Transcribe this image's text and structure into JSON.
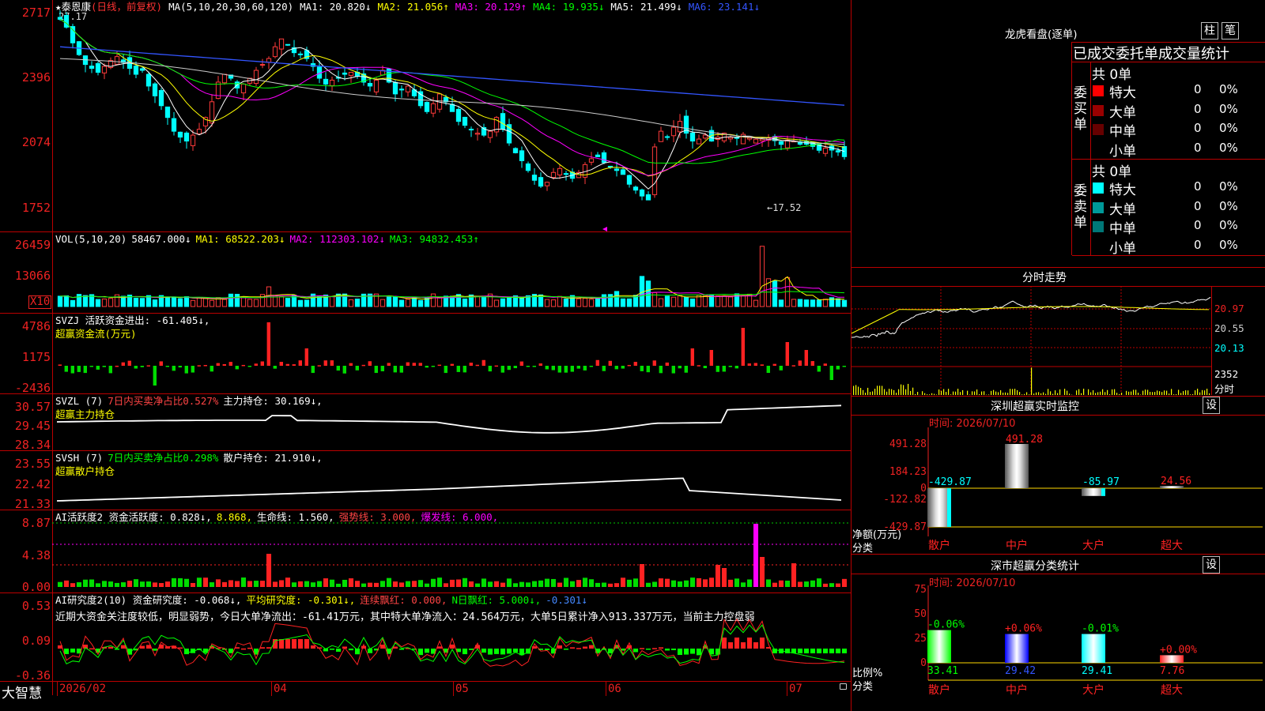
{
  "stock_name": "★泰恩康",
  "period": "(日线，前复权)",
  "high_mark": "27.17",
  "low_mark": "←17.52",
  "price_axis": [
    "2717",
    "2396",
    "2074",
    "1752"
  ],
  "ma_values": [
    {
      "label": "MA(5,10,20,30,60,120)",
      "color": "#ffffff"
    },
    {
      "label": "MA1: 20.820↓",
      "color": "#ffffff"
    },
    {
      "label": "MA2: 21.056↑",
      "color": "#ffff00"
    },
    {
      "label": "MA3: 20.129↑",
      "color": "#ff00ff"
    },
    {
      "label": "MA4: 19.935↓",
      "color": "#00ff00"
    },
    {
      "label": "MA5: 21.499↓",
      "color": "#ffffff"
    },
    {
      "label": "MA6: 23.141↓",
      "color": "#3355ff"
    }
  ],
  "vol": {
    "axis": [
      "26459",
      "13066",
      "X10"
    ],
    "title": [
      {
        "label": "VOL(5,10,20)",
        "color": "#ffffff"
      },
      {
        "label": "58467.000↓",
        "color": "#ffffff"
      },
      {
        "label": "MA1: 68522.203↓",
        "color": "#ffff00"
      },
      {
        "label": "MA2: 112303.102↓",
        "color": "#ff00ff"
      },
      {
        "label": "MA3: 94832.453↑",
        "color": "#00ff00"
      }
    ]
  },
  "svzj": {
    "axis": [
      "4786",
      "1175",
      "-2436"
    ],
    "title": [
      {
        "label": "SVZJ  活跃资金进出: -61.405↓,",
        "color": "#ffffff"
      }
    ],
    "subtitle": "超赢资金流(万元)"
  },
  "svzl": {
    "axis": [
      "30.57",
      "29.45",
      "28.34"
    ],
    "title": [
      {
        "label": "SVZL (7)",
        "color": "#ffffff"
      },
      {
        "label": "7日内买卖净占比0.527%",
        "color": "#ff4444"
      },
      {
        "label": "主力持仓: 30.169↓,",
        "color": "#ffffff"
      }
    ],
    "subtitle": "超赢主力持仓"
  },
  "svsh": {
    "axis": [
      "23.55",
      "22.42",
      "21.33"
    ],
    "title": [
      {
        "label": "SVSH (7)",
        "color": "#ffffff"
      },
      {
        "label": "7日内买卖净占比0.298%",
        "color": "#00ff00"
      },
      {
        "label": "散户持仓: 21.910↓,",
        "color": "#ffffff"
      }
    ],
    "subtitle": "超赢散户持仓"
  },
  "ai2": {
    "axis": [
      "8.87",
      "4.38",
      "0.00"
    ],
    "title": [
      {
        "label": "AI活跃度2 资金活跃度: 0.828↓,",
        "color": "#ffffff"
      },
      {
        "label": "8.868,",
        "color": "#ffff00"
      },
      {
        "label": "生命线: 1.560,",
        "color": "#ffffff"
      },
      {
        "label": "强势线: 3.000,",
        "color": "#ff4444"
      },
      {
        "label": "爆发线: 6.000,",
        "color": "#ff00ff"
      }
    ]
  },
  "research": {
    "axis": [
      "0.53",
      "0.09",
      "-0.36"
    ],
    "title": [
      {
        "label": "AI研究度2(10) 资金研究度: -0.068↓,",
        "color": "#ffffff"
      },
      {
        "label": "平均研究度: -0.301↓,",
        "color": "#ffff00"
      },
      {
        "label": "连续飘红: 0.000,",
        "color": "#ff4444"
      },
      {
        "label": "N日飘红: 5.000↓,",
        "color": "#00ff00"
      },
      {
        "label": "-0.301↓",
        "color": "#4488ff"
      }
    ],
    "comment": "近期大资金关注度较低，明显弱势，今日大单净流出：-61.41万元，其中特大单净流入：24.564万元，大单5日累计净入913.337万元，当前主力控盘弱"
  },
  "dates": [
    "2026/02",
    "04",
    "05",
    "06",
    "07"
  ],
  "brand": "大智慧",
  "lhb": {
    "title": "龙虎看盘(逐单)",
    "btn_bar": "柱",
    "btn_stroke": "笔",
    "subtitle": "已成交委托单成交量统计",
    "buy_label": "委买单",
    "sell_label": "委卖单",
    "buy_total": "共 0单",
    "sell_total": "共 0单",
    "buy_rows": [
      {
        "name": "特大",
        "count": "0",
        "pct": "0%",
        "color": "#ff0000"
      },
      {
        "name": "大单",
        "count": "0",
        "pct": "0%",
        "color": "#990000"
      },
      {
        "name": "中单",
        "count": "0",
        "pct": "0%",
        "color": "#660000"
      },
      {
        "name": "小单",
        "count": "0",
        "pct": "0%",
        "color": "#000000"
      }
    ],
    "sell_rows": [
      {
        "name": "特大",
        "count": "0",
        "pct": "0%",
        "color": "#00ffff"
      },
      {
        "name": "大单",
        "count": "0",
        "pct": "0%",
        "color": "#009999"
      },
      {
        "name": "中单",
        "count": "0",
        "pct": "0%",
        "color": "#007777"
      },
      {
        "name": "小单",
        "count": "0",
        "pct": "0%",
        "color": "#000000"
      }
    ]
  },
  "intraday": {
    "title": "分时走势",
    "axis_right": [
      "20.97",
      "20.55",
      "20.13",
      "2352",
      "分时"
    ]
  },
  "sz_monitor": {
    "title": "深圳超赢实时监控",
    "settings": "设",
    "time": "时间: 2026/07/10",
    "axis": [
      "491.28",
      "184.23",
      "0",
      "-122.82",
      "-429.87"
    ],
    "unit": "净额(万元)",
    "category_label": "分类",
    "categories": [
      "散户",
      "中户",
      "大户",
      "超大"
    ],
    "values": [
      -429.87,
      491.28,
      -85.97,
      24.56
    ],
    "value_labels": [
      "-429.87",
      "491.28",
      "-85.97",
      "24.56"
    ]
  },
  "sz_stats": {
    "title": "深市超赢分类统计",
    "settings": "设",
    "time": "时间: 2026/07/10",
    "axis": [
      "75",
      "50",
      "25",
      "0"
    ],
    "unit": "比例%",
    "category_label": "分类",
    "categories": [
      "散户",
      "中户",
      "大户",
      "超大"
    ],
    "values": [
      33.41,
      29.42,
      29.41,
      7.76
    ],
    "value_labels": [
      "33.41",
      "29.42",
      "29.41",
      "7.76"
    ],
    "change_labels": [
      "-0.06%",
      "+0.06%",
      "-0.01%",
      "+0.00%"
    ]
  }
}
